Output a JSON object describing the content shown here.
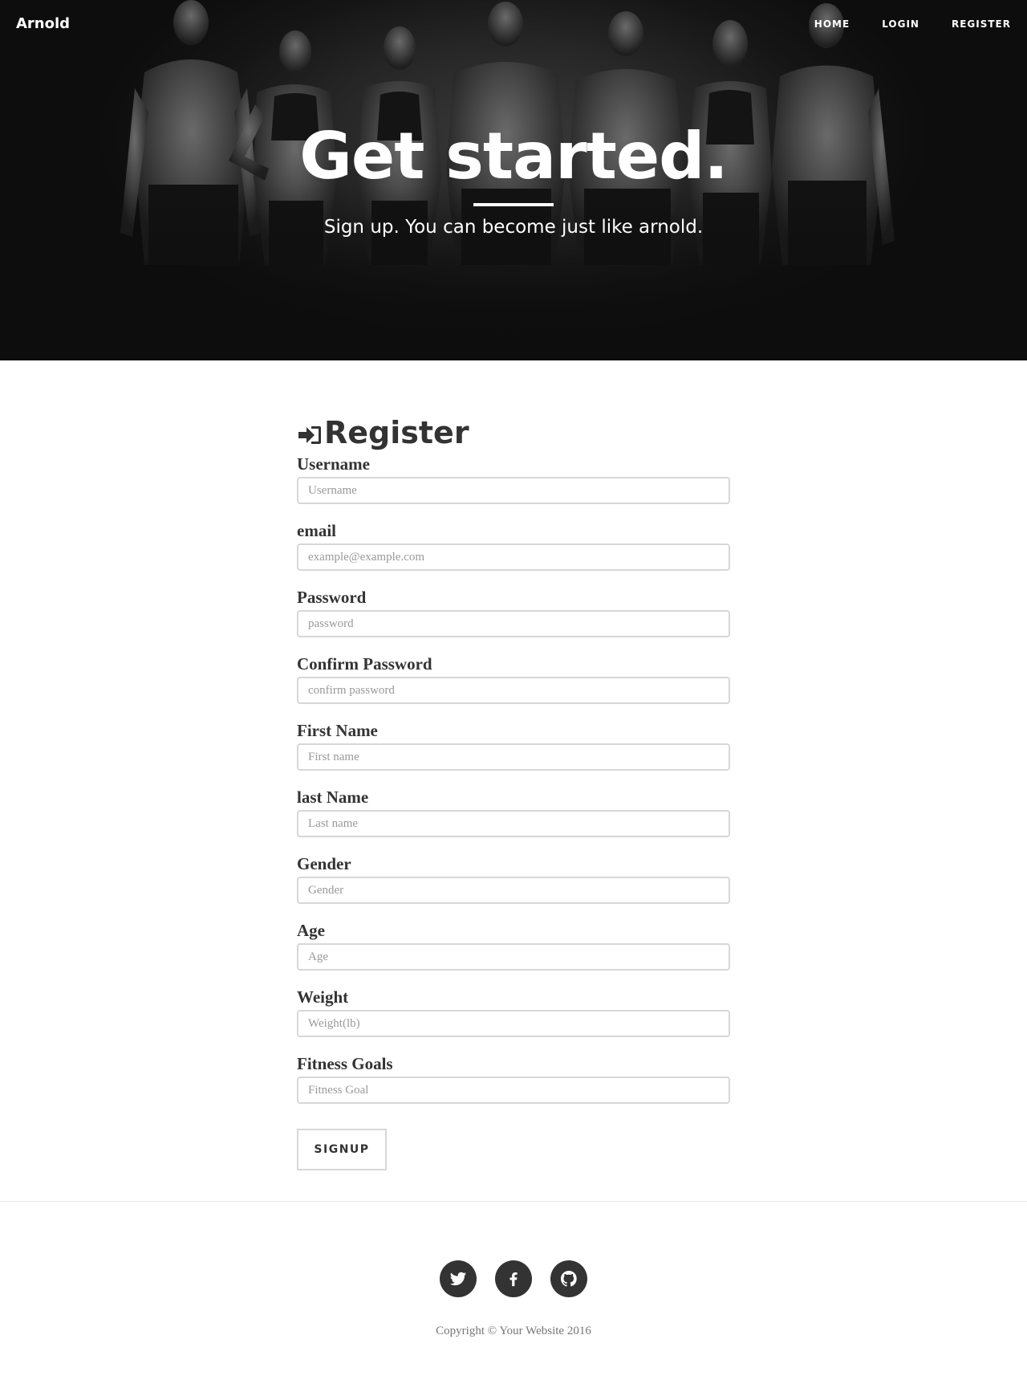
{
  "navbar": {
    "brand": "Arnold",
    "links": [
      "HOME",
      "LOGIN",
      "REGISTER"
    ]
  },
  "hero": {
    "title": "Get started.",
    "subtitle": "Sign up. You can become just like arnold."
  },
  "form": {
    "heading": "Register",
    "heading_icon": "sign-in-icon",
    "fields": [
      {
        "label": "Username",
        "placeholder": "Username",
        "value": ""
      },
      {
        "label": "email",
        "placeholder": "example@example.com",
        "value": ""
      },
      {
        "label": "Password",
        "placeholder": "password",
        "value": ""
      },
      {
        "label": "Confirm Password",
        "placeholder": "confirm password",
        "value": ""
      },
      {
        "label": "First Name",
        "placeholder": "First name",
        "value": ""
      },
      {
        "label": "last Name",
        "placeholder": "Last name",
        "value": ""
      },
      {
        "label": "Gender",
        "placeholder": "Gender",
        "value": ""
      },
      {
        "label": "Age",
        "placeholder": "Age",
        "value": ""
      },
      {
        "label": "Weight",
        "placeholder": "Weight(lb)",
        "value": ""
      },
      {
        "label": "Fitness Goals",
        "placeholder": "Fitness Goal",
        "value": ""
      }
    ],
    "submit_label": "SIGNUP"
  },
  "footer": {
    "social_icons": [
      "twitter-icon",
      "facebook-icon",
      "github-icon"
    ],
    "copyright": "Copyright © Your Website 2016"
  },
  "colors": {
    "hero_background": "#151515",
    "text_dark": "#333333",
    "input_border": "#d7d7d7",
    "placeholder": "#999999"
  }
}
